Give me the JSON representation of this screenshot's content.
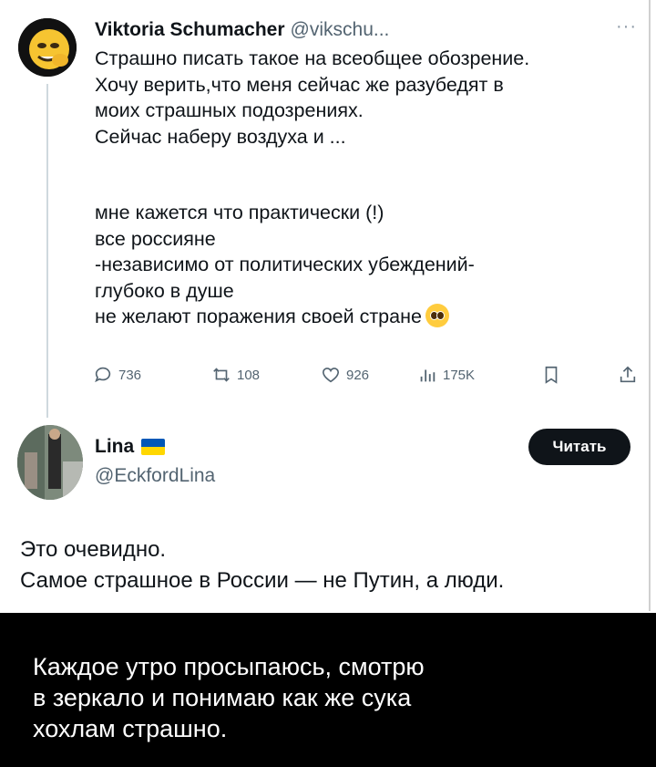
{
  "tweet1": {
    "author_name": "Viktoria Schumacher",
    "author_handle": "@vikschu...",
    "more_icon": "more-icon",
    "lines": [
      "Страшно писать такое на всеобщее обозрение.",
      "Хочу верить,что меня сейчас же разубедят в",
      "моих страшных подозрениях.",
      "Сейчас наберу воздуха и ..."
    ],
    "lines2": [
      "мне кажется что практически (!)",
      "все россияне",
      "-независимо от политических убеждений-",
      "глубоко в душе",
      "не желают поражения своей стране"
    ],
    "emoji": "pleading-face-emoji",
    "actions": {
      "replies": "736",
      "reposts": "108",
      "likes": "926",
      "views": "175K"
    }
  },
  "tweet2": {
    "author_name": "Lina",
    "flag": "ukraine-flag",
    "author_handle": "@EckfordLina",
    "follow_label": "Читать",
    "lines": [
      "Это очевидно.",
      "Самое страшное в России — не Путин, а люди."
    ]
  },
  "caption": {
    "lines": [
      "Каждое утро просыпаюсь, смотрю",
      "в зеркало и понимаю как же сука",
      "хохлам страшно."
    ]
  },
  "colors": {
    "text": "#0f1419",
    "secondary": "#536471",
    "button_bg": "#0f1419",
    "caption_bg": "#000000",
    "flag_blue": "#0057b7",
    "flag_yellow": "#ffd700"
  }
}
